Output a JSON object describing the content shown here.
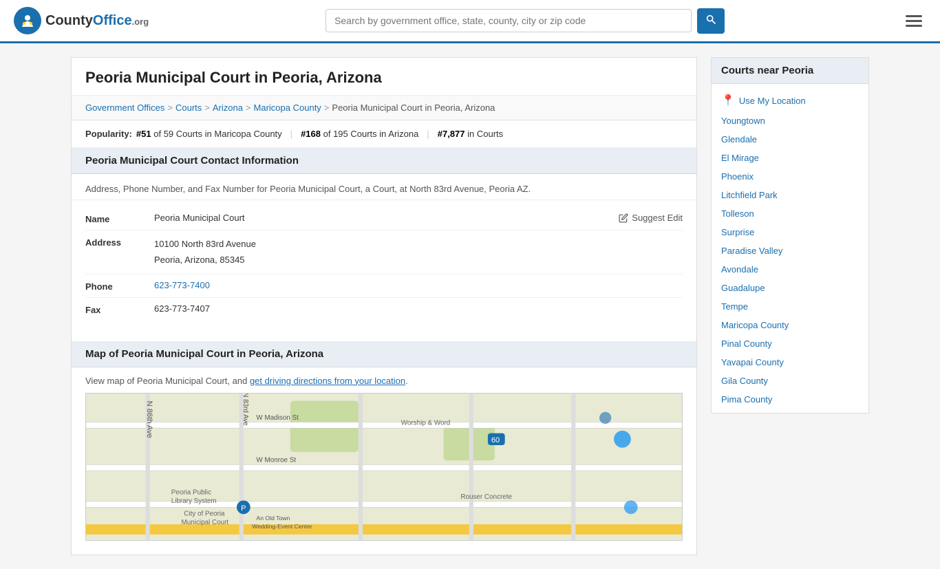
{
  "header": {
    "logo_text": "County",
    "logo_org": "Office.org",
    "search_placeholder": "Search by government office, state, county, city or zip code",
    "search_btn_label": "🔍",
    "menu_label": "Menu"
  },
  "page": {
    "title": "Peoria Municipal Court in Peoria, Arizona",
    "breadcrumb": [
      {
        "label": "Government Offices",
        "url": "#"
      },
      {
        "label": "Courts",
        "url": "#"
      },
      {
        "label": "Arizona",
        "url": "#"
      },
      {
        "label": "Maricopa County",
        "url": "#"
      },
      {
        "label": "Peoria Municipal Court in Peoria, Arizona",
        "url": "#"
      }
    ],
    "popularity": {
      "label": "Popularity:",
      "stat1_num": "#51",
      "stat1_text": "of 59 Courts in Maricopa County",
      "stat2_num": "#168",
      "stat2_text": "of 195 Courts in Arizona",
      "stat3_num": "#7,877",
      "stat3_text": "in Courts"
    },
    "contact_section": {
      "header": "Peoria Municipal Court Contact Information",
      "description": "Address, Phone Number, and Fax Number for Peoria Municipal Court, a Court, at North 83rd Avenue, Peoria AZ.",
      "fields": [
        {
          "key": "Name",
          "value": "Peoria Municipal Court",
          "is_link": false,
          "suggest_edit": true
        },
        {
          "key": "Address",
          "value_line1": "10100 North 83rd Avenue",
          "value_line2": "Peoria, Arizona, 85345",
          "is_address": true
        },
        {
          "key": "Phone",
          "value": "623-773-7400",
          "is_link": true
        },
        {
          "key": "Fax",
          "value": "623-773-7407",
          "is_link": false
        }
      ],
      "suggest_edit_label": "Suggest Edit"
    },
    "map_section": {
      "header": "Map of Peoria Municipal Court in Peoria, Arizona",
      "description_before": "View map of Peoria Municipal Court, and ",
      "description_link": "get driving directions from your location",
      "description_after": "."
    }
  },
  "sidebar": {
    "title": "Courts near Peoria",
    "use_my_location": "Use My Location",
    "items": [
      {
        "label": "Youngtown"
      },
      {
        "label": "Glendale"
      },
      {
        "label": "El Mirage"
      },
      {
        "label": "Phoenix"
      },
      {
        "label": "Litchfield Park"
      },
      {
        "label": "Tolleson"
      },
      {
        "label": "Surprise"
      },
      {
        "label": "Paradise Valley"
      },
      {
        "label": "Avondale"
      },
      {
        "label": "Guadalupe"
      },
      {
        "label": "Tempe"
      },
      {
        "label": "Maricopa County"
      },
      {
        "label": "Pinal County"
      },
      {
        "label": "Yavapai County"
      },
      {
        "label": "Gila County"
      },
      {
        "label": "Pima County"
      }
    ]
  }
}
